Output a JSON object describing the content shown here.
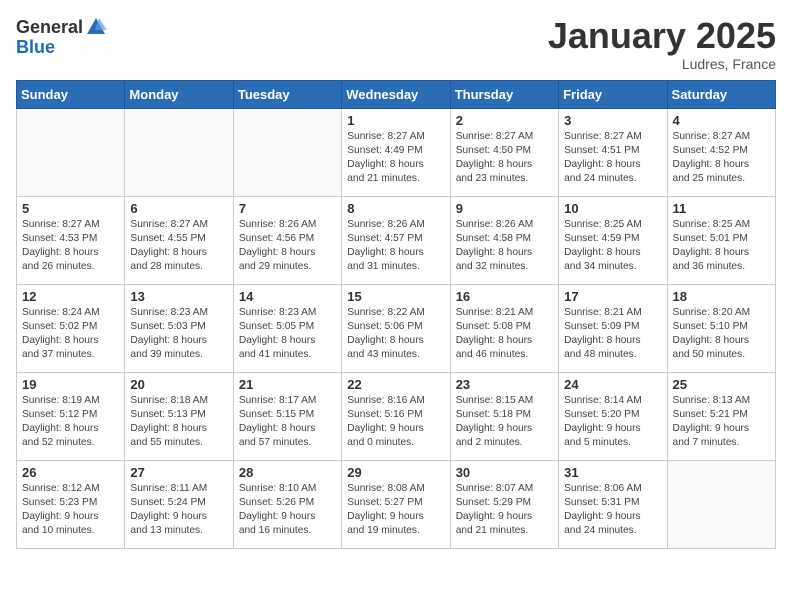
{
  "header": {
    "logo_general": "General",
    "logo_blue": "Blue",
    "month_title": "January 2025",
    "location": "Ludres, France"
  },
  "weekdays": [
    "Sunday",
    "Monday",
    "Tuesday",
    "Wednesday",
    "Thursday",
    "Friday",
    "Saturday"
  ],
  "weeks": [
    [
      {
        "day": "",
        "info": ""
      },
      {
        "day": "",
        "info": ""
      },
      {
        "day": "",
        "info": ""
      },
      {
        "day": "1",
        "info": "Sunrise: 8:27 AM\nSunset: 4:49 PM\nDaylight: 8 hours\nand 21 minutes."
      },
      {
        "day": "2",
        "info": "Sunrise: 8:27 AM\nSunset: 4:50 PM\nDaylight: 8 hours\nand 23 minutes."
      },
      {
        "day": "3",
        "info": "Sunrise: 8:27 AM\nSunset: 4:51 PM\nDaylight: 8 hours\nand 24 minutes."
      },
      {
        "day": "4",
        "info": "Sunrise: 8:27 AM\nSunset: 4:52 PM\nDaylight: 8 hours\nand 25 minutes."
      }
    ],
    [
      {
        "day": "5",
        "info": "Sunrise: 8:27 AM\nSunset: 4:53 PM\nDaylight: 8 hours\nand 26 minutes."
      },
      {
        "day": "6",
        "info": "Sunrise: 8:27 AM\nSunset: 4:55 PM\nDaylight: 8 hours\nand 28 minutes."
      },
      {
        "day": "7",
        "info": "Sunrise: 8:26 AM\nSunset: 4:56 PM\nDaylight: 8 hours\nand 29 minutes."
      },
      {
        "day": "8",
        "info": "Sunrise: 8:26 AM\nSunset: 4:57 PM\nDaylight: 8 hours\nand 31 minutes."
      },
      {
        "day": "9",
        "info": "Sunrise: 8:26 AM\nSunset: 4:58 PM\nDaylight: 8 hours\nand 32 minutes."
      },
      {
        "day": "10",
        "info": "Sunrise: 8:25 AM\nSunset: 4:59 PM\nDaylight: 8 hours\nand 34 minutes."
      },
      {
        "day": "11",
        "info": "Sunrise: 8:25 AM\nSunset: 5:01 PM\nDaylight: 8 hours\nand 36 minutes."
      }
    ],
    [
      {
        "day": "12",
        "info": "Sunrise: 8:24 AM\nSunset: 5:02 PM\nDaylight: 8 hours\nand 37 minutes."
      },
      {
        "day": "13",
        "info": "Sunrise: 8:23 AM\nSunset: 5:03 PM\nDaylight: 8 hours\nand 39 minutes."
      },
      {
        "day": "14",
        "info": "Sunrise: 8:23 AM\nSunset: 5:05 PM\nDaylight: 8 hours\nand 41 minutes."
      },
      {
        "day": "15",
        "info": "Sunrise: 8:22 AM\nSunset: 5:06 PM\nDaylight: 8 hours\nand 43 minutes."
      },
      {
        "day": "16",
        "info": "Sunrise: 8:21 AM\nSunset: 5:08 PM\nDaylight: 8 hours\nand 46 minutes."
      },
      {
        "day": "17",
        "info": "Sunrise: 8:21 AM\nSunset: 5:09 PM\nDaylight: 8 hours\nand 48 minutes."
      },
      {
        "day": "18",
        "info": "Sunrise: 8:20 AM\nSunset: 5:10 PM\nDaylight: 8 hours\nand 50 minutes."
      }
    ],
    [
      {
        "day": "19",
        "info": "Sunrise: 8:19 AM\nSunset: 5:12 PM\nDaylight: 8 hours\nand 52 minutes."
      },
      {
        "day": "20",
        "info": "Sunrise: 8:18 AM\nSunset: 5:13 PM\nDaylight: 8 hours\nand 55 minutes."
      },
      {
        "day": "21",
        "info": "Sunrise: 8:17 AM\nSunset: 5:15 PM\nDaylight: 8 hours\nand 57 minutes."
      },
      {
        "day": "22",
        "info": "Sunrise: 8:16 AM\nSunset: 5:16 PM\nDaylight: 9 hours\nand 0 minutes."
      },
      {
        "day": "23",
        "info": "Sunrise: 8:15 AM\nSunset: 5:18 PM\nDaylight: 9 hours\nand 2 minutes."
      },
      {
        "day": "24",
        "info": "Sunrise: 8:14 AM\nSunset: 5:20 PM\nDaylight: 9 hours\nand 5 minutes."
      },
      {
        "day": "25",
        "info": "Sunrise: 8:13 AM\nSunset: 5:21 PM\nDaylight: 9 hours\nand 7 minutes."
      }
    ],
    [
      {
        "day": "26",
        "info": "Sunrise: 8:12 AM\nSunset: 5:23 PM\nDaylight: 9 hours\nand 10 minutes."
      },
      {
        "day": "27",
        "info": "Sunrise: 8:11 AM\nSunset: 5:24 PM\nDaylight: 9 hours\nand 13 minutes."
      },
      {
        "day": "28",
        "info": "Sunrise: 8:10 AM\nSunset: 5:26 PM\nDaylight: 9 hours\nand 16 minutes."
      },
      {
        "day": "29",
        "info": "Sunrise: 8:08 AM\nSunset: 5:27 PM\nDaylight: 9 hours\nand 19 minutes."
      },
      {
        "day": "30",
        "info": "Sunrise: 8:07 AM\nSunset: 5:29 PM\nDaylight: 9 hours\nand 21 minutes."
      },
      {
        "day": "31",
        "info": "Sunrise: 8:06 AM\nSunset: 5:31 PM\nDaylight: 9 hours\nand 24 minutes."
      },
      {
        "day": "",
        "info": ""
      }
    ]
  ]
}
